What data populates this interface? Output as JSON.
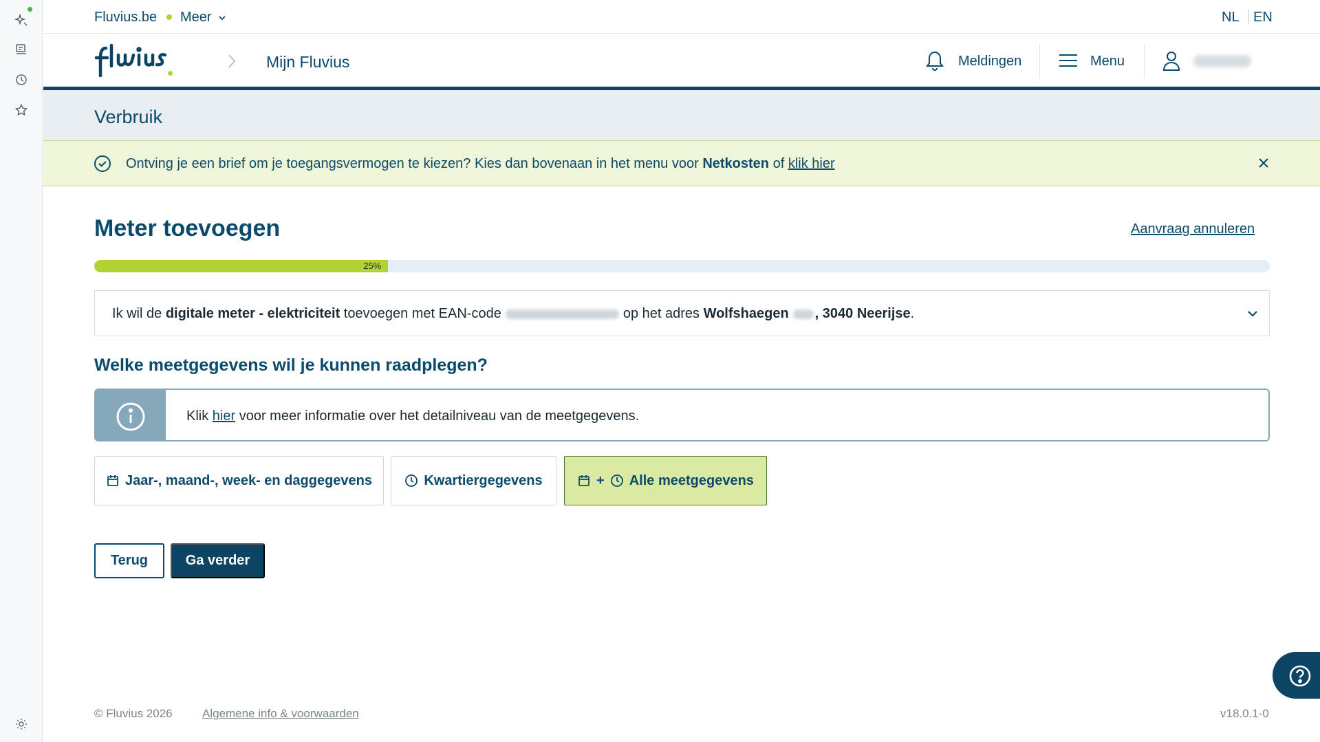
{
  "utility": {
    "site_link": "Fluvius.be",
    "more_label": "Meer",
    "lang_nl": "NL",
    "lang_en": "EN"
  },
  "header": {
    "breadcrumb_title": "Mijn Fluvius",
    "notifications_label": "Meldingen",
    "menu_label": "Menu"
  },
  "section": {
    "title": "Verbruik"
  },
  "notice": {
    "text_before": "Ontving je een brief om je toegangsvermogen te kiezen? Kies dan bovenaan in het menu voor ",
    "bold": "Netkosten",
    "text_mid": " of ",
    "link": "klik hier"
  },
  "page": {
    "title": "Meter toevoegen",
    "cancel_link": "Aanvraag annuleren",
    "progress_label": "25%",
    "progress_value": 0.25
  },
  "summary": {
    "t1": "Ik wil de ",
    "b1": "digitale meter - elektriciteit",
    "t2": " toevoegen met EAN-code",
    "t3": "op het adres ",
    "b2": "Wolfshaegen",
    "b3": ", 3040 Neerijse",
    "t4": "."
  },
  "question": {
    "title": "Welke meetgegevens wil je kunnen raadplegen?",
    "info_before": "Klik ",
    "info_link": "hier",
    "info_after": " voor meer informatie over het detailniveau van de meetgegevens."
  },
  "options": {
    "opt1": "Jaar-, maand-, week- en daggegevens",
    "opt2": "Kwartiergegevens",
    "opt3_plus": "+",
    "opt3": "Alle meetgegevens",
    "selected": "opt3"
  },
  "actions": {
    "back": "Terug",
    "next": "Ga verder"
  },
  "footer": {
    "copyright": "© Fluvius 2026",
    "terms_link": "Algemene info & voorwaarden",
    "version": "v18.0.1-0"
  },
  "colors": {
    "brand_blue": "#0b4563",
    "accent_green": "#b3d234",
    "selected_bg": "#daeaa3"
  }
}
